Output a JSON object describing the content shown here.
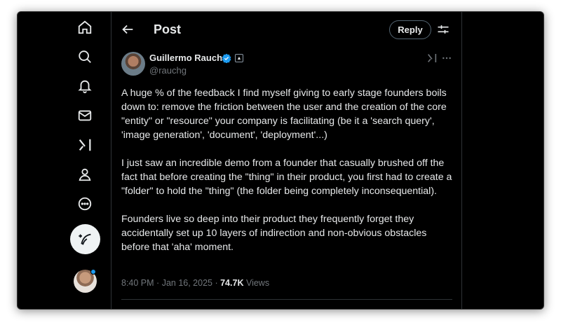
{
  "header": {
    "title": "Post",
    "reply_label": "Reply"
  },
  "sidebar": {
    "items": [
      {
        "icon": "home-icon"
      },
      {
        "icon": "search-icon"
      },
      {
        "icon": "notifications-icon"
      },
      {
        "icon": "messages-icon"
      },
      {
        "icon": "grok-icon"
      },
      {
        "icon": "profile-icon"
      },
      {
        "icon": "more-icon"
      }
    ],
    "compose_icon": "compose-icon"
  },
  "tweet": {
    "author_name": "Guillermo Rauch",
    "author_handle": "@rauchg",
    "paragraphs": [
      "A huge % of the feedback I find myself giving to early stage founders boils down to: remove the friction between the user and the creation of the core \"entity\" or \"resource\" your company is facilitating (be it a 'search query', 'image generation', 'document', 'deployment'...)",
      "I just saw an incredible demo from a founder that casually brushed off the fact that before creating the \"thing\" in their product, you first had to create a \"folder\" to hold the \"thing\" (the folder being completely inconsequential).",
      "Founders live so deep into their product they frequently forget they accidentally set up 10 layers of indirection and non-obvious obstacles before that 'aha' moment."
    ],
    "time": "8:40 PM",
    "date": "Jan 16, 2025",
    "views_count": "74.7K",
    "views_label": "Views"
  },
  "colors": {
    "background": "#000000",
    "text": "#e7e9ea",
    "muted": "#71767b",
    "verified": "#1d9bf0",
    "border": "#2f3336"
  }
}
